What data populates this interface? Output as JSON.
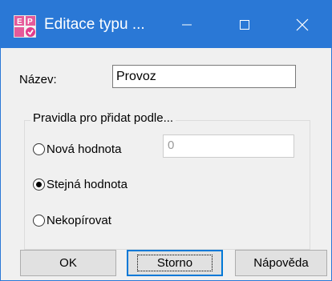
{
  "window": {
    "title": "Editace typu ...",
    "accent_color": "#2a78d6",
    "controls": {
      "minimize_icon": "minimize-icon",
      "maximize_icon": "maximize-icon",
      "close_icon": "close-icon"
    }
  },
  "form": {
    "name_label": "Název:",
    "name_value": "Provoz"
  },
  "rules_group": {
    "legend": "Pravidla pro přidat podle...",
    "options": [
      {
        "label": "Nová hodnota",
        "checked": false
      },
      {
        "label": "Stejná hodnota",
        "checked": true
      },
      {
        "label": "Nekopírovat",
        "checked": false
      }
    ],
    "new_value_field": "0"
  },
  "buttons": {
    "ok": "OK",
    "cancel": "Storno",
    "help": "Nápověda"
  }
}
